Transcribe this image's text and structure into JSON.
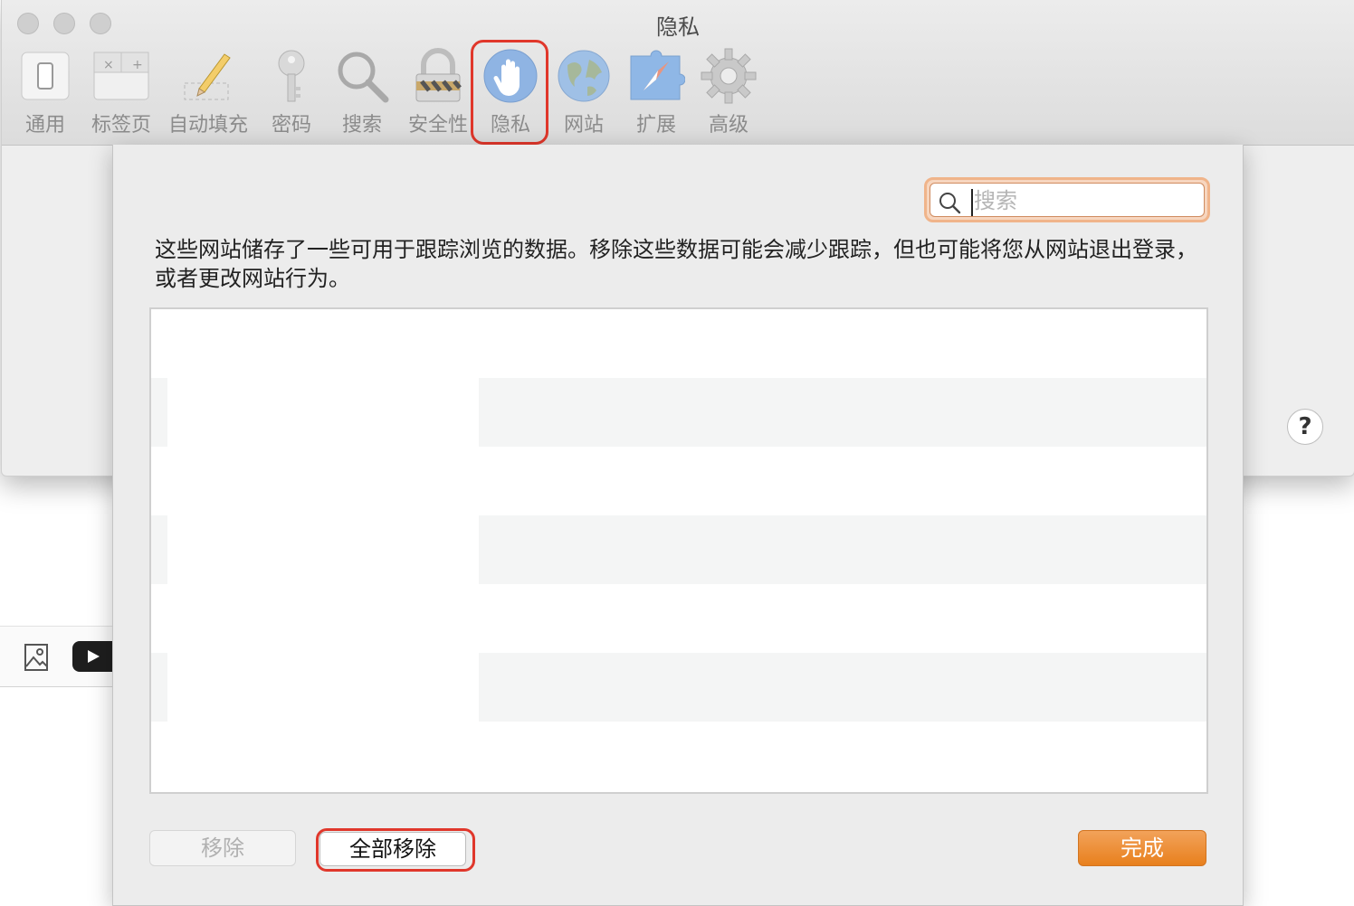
{
  "window": {
    "title": "隐私"
  },
  "toolbar": {
    "items": [
      {
        "id": "general",
        "label": "通用"
      },
      {
        "id": "tabs",
        "label": "标签页"
      },
      {
        "id": "autofill",
        "label": "自动填充"
      },
      {
        "id": "passwords",
        "label": "密码"
      },
      {
        "id": "search",
        "label": "搜索"
      },
      {
        "id": "security",
        "label": "安全性"
      },
      {
        "id": "privacy",
        "label": "隐私"
      },
      {
        "id": "websites",
        "label": "网站"
      },
      {
        "id": "extensions",
        "label": "扩展"
      },
      {
        "id": "advanced",
        "label": "高级"
      }
    ],
    "selected": "privacy"
  },
  "sheet": {
    "search": {
      "placeholder": "搜索",
      "value": ""
    },
    "description": "这些网站储存了一些可用于跟踪浏览的数据。移除这些数据可能会减少跟踪，但也可能将您从网站退出登录，或者更改网站行为。",
    "website_rows": [],
    "buttons": {
      "remove": "移除",
      "remove_all": "全部移除",
      "done": "完成"
    }
  },
  "help": {
    "label": "?"
  },
  "colors": {
    "accent": "#e8801d",
    "highlight_ring": "#e0372b"
  }
}
